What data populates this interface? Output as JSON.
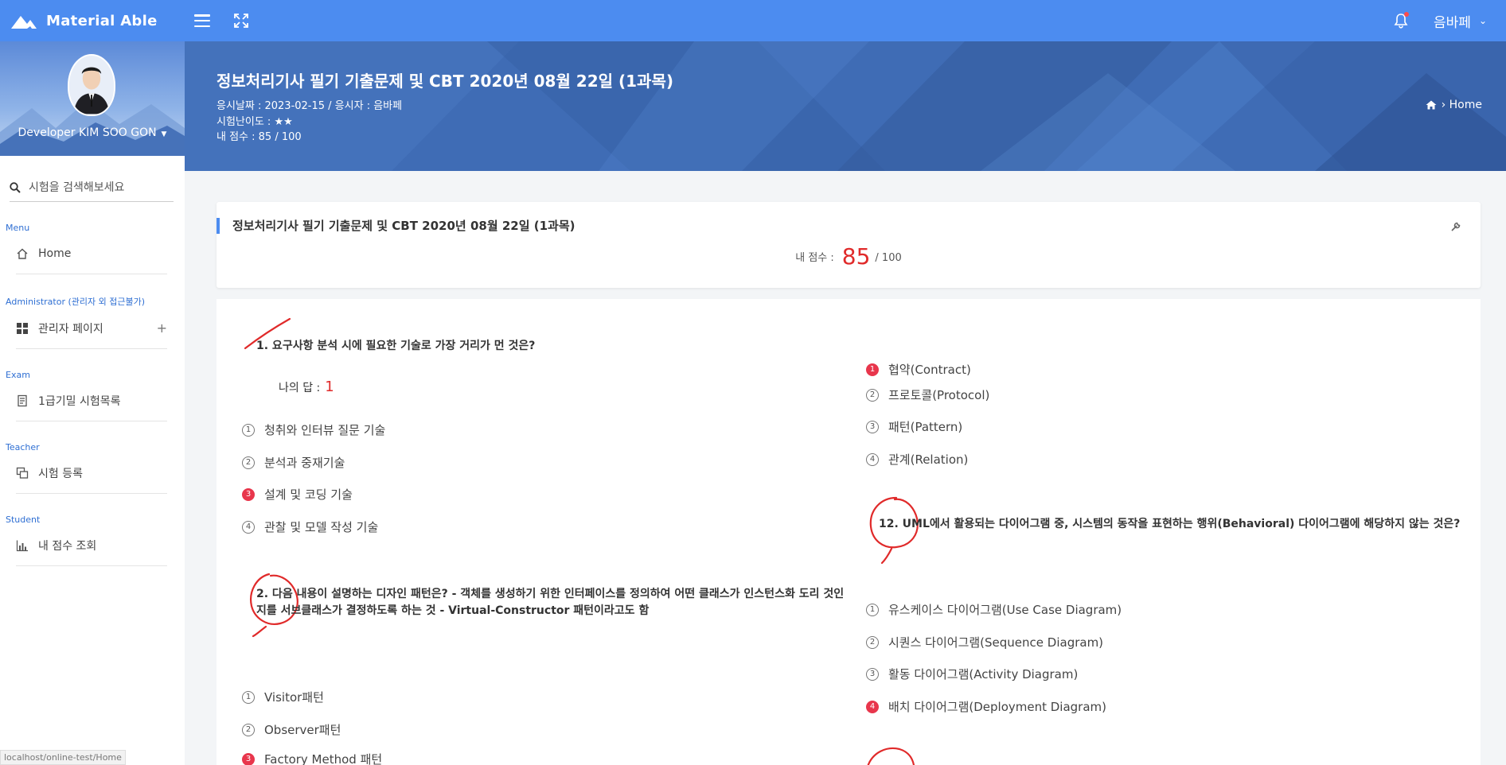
{
  "app": {
    "brand": "Material Able",
    "user_name": "음바페"
  },
  "profile": {
    "name": "Developer KIM SOO GON"
  },
  "search": {
    "placeholder": "시험을 검색해보세요"
  },
  "sidebar": {
    "sections": [
      {
        "title": "Menu",
        "items": [
          {
            "label": "Home",
            "icon": "home-icon"
          }
        ]
      },
      {
        "title": "Administrator (관리자 외 접근불가)",
        "items": [
          {
            "label": "관리자 페이지",
            "icon": "grid-icon"
          }
        ]
      },
      {
        "title": "Exam",
        "items": [
          {
            "label": "1급기밀 시험목록",
            "icon": "document-icon"
          }
        ]
      },
      {
        "title": "Teacher",
        "items": [
          {
            "label": "시험 등록",
            "icon": "copy-icon"
          }
        ]
      },
      {
        "title": "Student",
        "items": [
          {
            "label": "내 점수 조회",
            "icon": "bar-chart-icon"
          }
        ]
      }
    ]
  },
  "header": {
    "title": "정보처리기사 필기 기출문제 및 CBT 2020년 08월 22일 (1과목)",
    "meta_date": "응시날짜 : 2023-02-15 / 응시자 : 음바페",
    "meta_difficulty": "시험난이도 : ★★",
    "meta_score": "내 점수 : 85 / 100",
    "breadcrumb": "Home"
  },
  "card": {
    "title": "정보처리기사 필기 기출문제 및 CBT 2020년 08월 22일 (1과목)",
    "score_label": "내 점수 :",
    "score": "85",
    "score_total": "/ 100"
  },
  "questions": {
    "q1": {
      "text": "1. 요구사항 분석 시에 필요한 기술로 가장 거리가 먼 것은?",
      "answer_label": "나의 답 :",
      "answer_value": "1",
      "options": [
        {
          "num": "1",
          "text": "청취와 인터뷰 질문 기술",
          "selected": false
        },
        {
          "num": "2",
          "text": "분석과 중재기술",
          "selected": false
        },
        {
          "num": "3",
          "text": "설계 및 코딩 기술",
          "selected": true
        },
        {
          "num": "4",
          "text": "관찰 및 모델 작성 기술",
          "selected": false
        }
      ]
    },
    "q2": {
      "text_line1": "2. 다음 내용이 설명하는 디자인 패턴은? - 객체를 생성하기 위한 인터페이스를 정의하여 어떤 클래스가 인스턴스화 도리 것인",
      "text_line2": "지를 서브클래스가 결정하도록 하는 것 - Virtual-Constructor 패턴이라고도 함",
      "options": [
        {
          "num": "1",
          "text": "Visitor패턴",
          "selected": false
        },
        {
          "num": "2",
          "text": "Observer패턴",
          "selected": false
        },
        {
          "num": "3",
          "text": "Factory Method 패턴",
          "selected": true
        }
      ]
    },
    "q11_options": [
      {
        "num": "1",
        "text": "협약(Contract)",
        "selected": true
      },
      {
        "num": "2",
        "text": "프로토콜(Protocol)",
        "selected": false
      },
      {
        "num": "3",
        "text": "패턴(Pattern)",
        "selected": false
      },
      {
        "num": "4",
        "text": "관계(Relation)",
        "selected": false
      }
    ],
    "q12": {
      "text": "12. UML에서 활용되는 다이어그램 중, 시스템의 동작을 표현하는 행위(Behavioral) 다이어그램에 해당하지 않는 것은?",
      "options": [
        {
          "num": "1",
          "text": "유스케이스 다이어그램(Use Case Diagram)",
          "selected": false
        },
        {
          "num": "2",
          "text": "시퀀스 다이어그램(Sequence Diagram)",
          "selected": false
        },
        {
          "num": "3",
          "text": "활동 다이어그램(Activity Diagram)",
          "selected": false
        },
        {
          "num": "4",
          "text": "배치 다이어그램(Deployment Diagram)",
          "selected": true
        }
      ]
    }
  },
  "status_url": "localhost/online-test/Home",
  "colors": {
    "primary": "#4c8cf0",
    "banner": "#3f6cb5",
    "accent_red": "#e02a2a",
    "selected_badge": "#e8364c"
  }
}
